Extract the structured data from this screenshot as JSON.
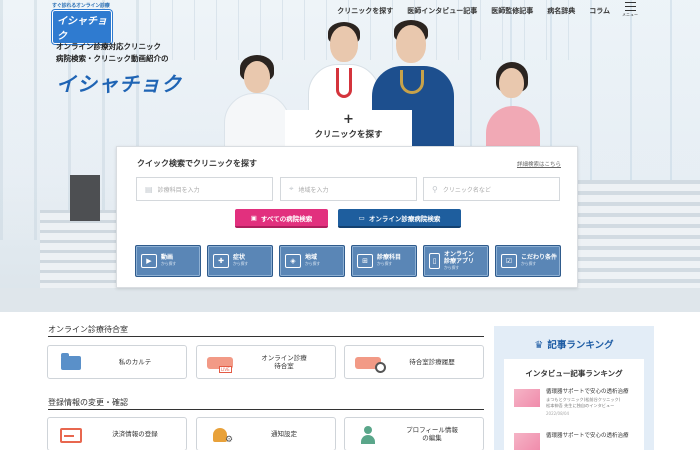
{
  "header": {
    "logo_tagline": "すぐ診れるオンライン診療",
    "logo_text": "イシャチョク",
    "nav": [
      "クリニックを探す",
      "医師インタビュー記事",
      "医師監修記事",
      "病名辞典",
      "コラム"
    ],
    "menu_label": "メニュー"
  },
  "hero": {
    "line1": "オンライン診療対応クリニック",
    "line2": "病院検索・クリニック動画紹介の",
    "brand": "イシャチョク"
  },
  "search": {
    "tab_plus": "+",
    "tab_label": "クリニックを探す",
    "title": "クイック検索でクリニックを探す",
    "advanced_link": "詳細検索はこちら",
    "fields": [
      {
        "placeholder": "診療科目を入力",
        "icon": "clipboard-icon"
      },
      {
        "placeholder": "地域を入力",
        "icon": "map-pin-icon"
      },
      {
        "placeholder": "クリニック名など",
        "icon": "search-icon"
      }
    ],
    "btn_all": "すべての病院検索",
    "btn_online": "オンライン診療病院検索",
    "categories": [
      {
        "label": "動画",
        "sub": "から探す",
        "icon": "video-icon"
      },
      {
        "label": "症状",
        "sub": "から探す",
        "icon": "first-aid-icon"
      },
      {
        "label": "地域",
        "sub": "から探す",
        "icon": "map-icon"
      },
      {
        "label": "診療科目",
        "sub": "から探す",
        "icon": "hospital-icon"
      },
      {
        "label": "オンライン\n診療アプリ",
        "sub": "から探す",
        "icon": "smartphone-icon"
      },
      {
        "label": "こだわり条件",
        "sub": "から探す",
        "icon": "checklist-icon"
      }
    ]
  },
  "waiting_room": {
    "title": "オンライン診療待合室",
    "cards": [
      {
        "label": "私のカルテ"
      },
      {
        "label": "オンライン診療\n待合室",
        "badge": "LIVE"
      },
      {
        "label": "待合室診療履歴"
      }
    ]
  },
  "registration": {
    "title": "登録情報の変更・確認",
    "cards": [
      {
        "label": "決済情報の登録"
      },
      {
        "label": "通知設定"
      },
      {
        "label": "プロフィール情報\nの編集"
      }
    ]
  },
  "ranking": {
    "title": "記事ランキング",
    "subtitle": "インタビュー記事ランキング",
    "items": [
      {
        "title": "循環器サポートで安心の透析治療",
        "clinic": "まつもとクリニック(松前谷クリニック)",
        "doctor": "松本伸吾 先生に独自のインタビュー",
        "date": "2022/08/04"
      },
      {
        "title": "循環器サポートで安心の透析治療"
      }
    ]
  }
}
